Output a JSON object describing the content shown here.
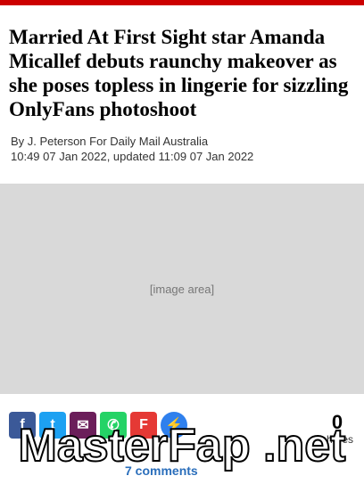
{
  "headline": "Married At First Sight star Amanda Micallef debuts raunchy makeover as she poses topless in lingerie for sizzling OnlyFans photoshoot",
  "byline": "By J. Peterson For Daily Mail Australia",
  "timestamp": "10:49 07 Jan 2022, updated 11:09 07 Jan 2022",
  "image_placeholder": "[image area]",
  "share": {
    "count": "0",
    "label": "shares"
  },
  "comments": "7 comments",
  "watermark": "MasterFap .net"
}
